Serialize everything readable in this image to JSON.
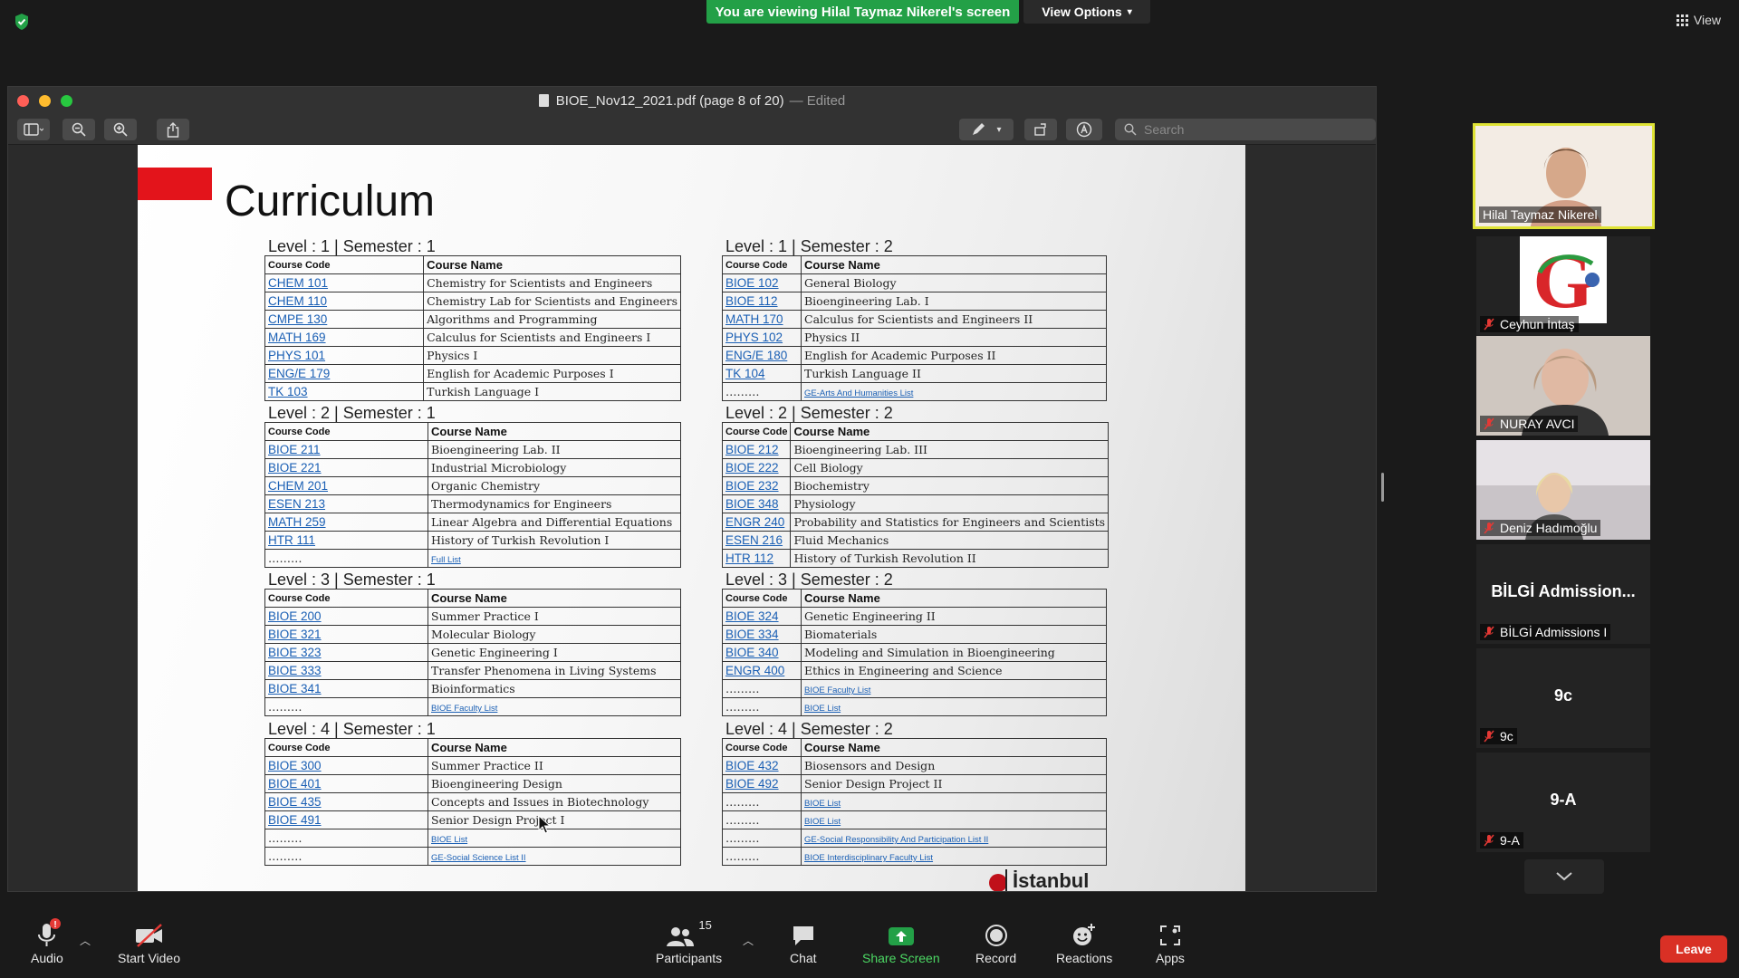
{
  "banner": {
    "viewing": "You are viewing Hilal Taymaz Nikerel's screen",
    "view_options": "View Options",
    "view": "View"
  },
  "window": {
    "filename": "BIOE_Nov12_2021.pdf (page 8 of 20)",
    "edited": "— Edited",
    "search_placeholder": "Search"
  },
  "doc": {
    "title": "Curriculum",
    "header_code": "Course Code",
    "header_name": "Course Name",
    "blocks": [
      {
        "level": "Level : 1 | Semester : 1",
        "rows": [
          [
            "CHEM 101",
            "Chemistry for Scientists and Engineers"
          ],
          [
            "CHEM 110",
            "Chemistry Lab for Scientists and Engineers"
          ],
          [
            "CMPE 130",
            "Algorithms and Programming"
          ],
          [
            "MATH 169",
            "Calculus for Scientists and Engineers I"
          ],
          [
            "PHYS 101",
            "Physics I"
          ],
          [
            "ENG/E 179",
            "English for Academic Purposes I"
          ],
          [
            "TK 103",
            "Turkish Language I"
          ]
        ]
      },
      {
        "level": "Level : 1 | Semester : 2",
        "rows": [
          [
            "BIOE 102",
            "General Biology"
          ],
          [
            "BIOE 112",
            "Bioengineering Lab. I"
          ],
          [
            "MATH 170",
            "Calculus for Scientists and Engineers II"
          ],
          [
            "PHYS 102",
            "Physics II"
          ],
          [
            "ENG/E 180",
            "English for Academic Purposes II"
          ],
          [
            "TK 104",
            "Turkish Language II"
          ],
          [
            "………",
            "GE-Arts And Humanities List"
          ]
        ]
      },
      {
        "level": "Level : 2 | Semester : 1",
        "rows": [
          [
            "BIOE 211",
            "Bioengineering Lab. II"
          ],
          [
            "BIOE 221",
            "Industrial Microbiology"
          ],
          [
            "CHEM 201",
            "Organic Chemistry"
          ],
          [
            "ESEN 213",
            "Thermodynamics for Engineers"
          ],
          [
            "MATH 259",
            "Linear Algebra and Differential Equations"
          ],
          [
            "HTR 111",
            "History of Turkish Revolution I"
          ],
          [
            "………",
            "Full List"
          ]
        ]
      },
      {
        "level": "Level : 2 | Semester : 2",
        "rows": [
          [
            "BIOE 212",
            "Bioengineering Lab. III"
          ],
          [
            "BIOE 222",
            "Cell Biology"
          ],
          [
            "BIOE 232",
            "Biochemistry"
          ],
          [
            "BIOE 348",
            "Physiology"
          ],
          [
            "ENGR 240",
            "Probability and Statistics for Engineers and Scientists"
          ],
          [
            "ESEN 216",
            "Fluid Mechanics"
          ],
          [
            "HTR 112",
            "History of Turkish Revolution II"
          ]
        ]
      },
      {
        "level": "Level : 3 | Semester : 1",
        "rows": [
          [
            "BIOE 200",
            "Summer Practice I"
          ],
          [
            "BIOE 321",
            "Molecular Biology"
          ],
          [
            "BIOE 323",
            "Genetic Engineering I"
          ],
          [
            "BIOE 333",
            "Transfer Phenomena in Living Systems"
          ],
          [
            "BIOE 341",
            "Bioinformatics"
          ],
          [
            "………",
            "BIOE Faculty List"
          ]
        ]
      },
      {
        "level": "Level : 3 | Semester : 2",
        "rows": [
          [
            "BIOE 324",
            "Genetic Engineering II"
          ],
          [
            "BIOE 334",
            "Biomaterials"
          ],
          [
            "BIOE 340",
            "Modeling and Simulation in Bioengineering"
          ],
          [
            "ENGR 400",
            "Ethics in Engineering and Science"
          ],
          [
            "………",
            "BIOE Faculty List"
          ],
          [
            "………",
            "BIOE List"
          ]
        ]
      },
      {
        "level": "Level : 4 | Semester : 1",
        "rows": [
          [
            "BIOE 300",
            "Summer Practice II"
          ],
          [
            "BIOE 401",
            "Bioengineering Design"
          ],
          [
            "BIOE 435",
            "Concepts and Issues in Biotechnology"
          ],
          [
            "BIOE 491",
            "Senior Design Project I"
          ],
          [
            "………",
            "BIOE List"
          ],
          [
            "………",
            "GE-Social Science List II"
          ]
        ]
      },
      {
        "level": "Level : 4 | Semester : 2",
        "rows": [
          [
            "BIOE 432",
            "Biosensors and Design"
          ],
          [
            "BIOE 492",
            "Senior Design Project II"
          ],
          [
            "………",
            "BIOE List"
          ],
          [
            "………",
            "BIOE List"
          ],
          [
            "………",
            "GE-Social Responsibility And Participation List II"
          ],
          [
            "………",
            "BIOE Interdisciplinary Faculty List"
          ]
        ]
      }
    ],
    "footer_logo": "İstanbul"
  },
  "participants": [
    {
      "name": "Hilal Taymaz Nikerel",
      "muted": false,
      "active": true
    },
    {
      "name": "Ceyhun İntaş",
      "muted": true
    },
    {
      "name": "NURAY AVCI",
      "muted": true
    },
    {
      "name": "Deniz Hadımoğlu",
      "muted": true
    },
    {
      "name": "BİLGİ Admissions I",
      "display": "BİLGİ Admission...",
      "muted": true
    },
    {
      "name": "9c",
      "display": "9c",
      "muted": true
    },
    {
      "name": "9-A",
      "display": "9-A",
      "muted": true
    }
  ],
  "controls": {
    "audio": "Audio",
    "start_video": "Start Video",
    "participants": "Participants",
    "participants_count": "15",
    "chat": "Chat",
    "share_screen": "Share Screen",
    "record": "Record",
    "reactions": "Reactions",
    "apps": "Apps",
    "leave": "Leave"
  },
  "colors": {
    "banner_green": "#23a047",
    "leave_red": "#d93025",
    "active_speaker": "#dfe335",
    "link_blue": "#1a5fb4",
    "share_green": "#4cd964"
  }
}
